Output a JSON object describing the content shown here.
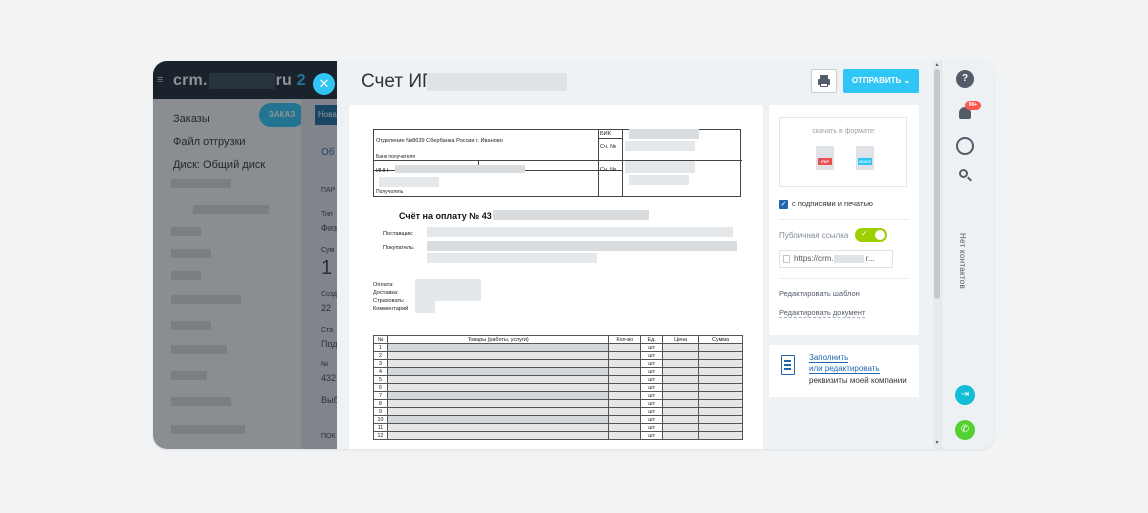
{
  "background_app": {
    "logo_prefix": "crm.",
    "logo_suffix": "ru",
    "logo_number": "2",
    "menu": [
      "Заказы",
      "Файл отгрузки",
      "Диск: Общий диск"
    ],
    "order_button": "ЗАКАЗ",
    "new_chip": "Нова",
    "mid_texts": [
      "Об",
      "ПАР",
      "Тип",
      "Физ",
      "Сум",
      "1",
      "Созд",
      "22",
      "Ста",
      "Под",
      "№",
      "432",
      "Выб",
      "ПОК"
    ]
  },
  "slider": {
    "title": "Счет ИП",
    "send_button": "ОТПРАВИТЬ"
  },
  "document": {
    "bank_name": "Отделение №8639 Сбербанка России г. Иваново",
    "bank_recipient_label": "Банк получателя",
    "bik_label": "БИК",
    "account_label_1": "Сч. №",
    "inn_label": "ИНН",
    "account_label_2": "Сч. №",
    "recipient_label": "Получатель",
    "invoice_title": "Счёт на оплату № 43",
    "supplier_label": "Поставщик:",
    "buyer_label": "Покупатель:",
    "payment_label": "Оплата:",
    "delivery_label": "Доставка:",
    "insure_label": "Страховать:",
    "comment_label": "Комментарий",
    "goods_table": {
      "headers": [
        "№",
        "Товары (работы, услуги)",
        "Кол-во",
        "Ед.",
        "Цена",
        "Сумма"
      ],
      "rows": [
        {
          "n": "1",
          "unit": "шт"
        },
        {
          "n": "2",
          "unit": "шт"
        },
        {
          "n": "3",
          "unit": "шт"
        },
        {
          "n": "4",
          "unit": "шт"
        },
        {
          "n": "5",
          "unit": "шт"
        },
        {
          "n": "6",
          "unit": "шт"
        },
        {
          "n": "7",
          "unit": "шт"
        },
        {
          "n": "8",
          "unit": "шт"
        },
        {
          "n": "9",
          "unit": "шт"
        },
        {
          "n": "10",
          "unit": "шт"
        },
        {
          "n": "11",
          "unit": "шт"
        },
        {
          "n": "12",
          "unit": "шт"
        }
      ]
    }
  },
  "settings": {
    "download_label": "скачать в формате:",
    "pdf_label": "PDF",
    "docx_label": "DOCX",
    "sign_checkbox_label": "с подписями и печатью",
    "sign_checked": true,
    "public_link_label": "Публичная ссылка",
    "public_link_on": true,
    "link_prefix": "https://crm.",
    "link_suffix": "r...",
    "edit_template": "Редактировать шаблон",
    "edit_document": "Редактировать документ",
    "company_fill": "Заполнить",
    "company_edit": "или редактировать",
    "company_req": "реквизиты моей компании"
  },
  "right_bar": {
    "help": "?",
    "notif_badge": "99+",
    "vertical_text": "Нет контактов"
  },
  "colors": {
    "accent": "#2fc6f6",
    "link": "#2067b0",
    "toggle_on": "#9dcf00",
    "phone": "#55d033",
    "pdf": "#e85052",
    "docx": "#2fc6f6"
  }
}
